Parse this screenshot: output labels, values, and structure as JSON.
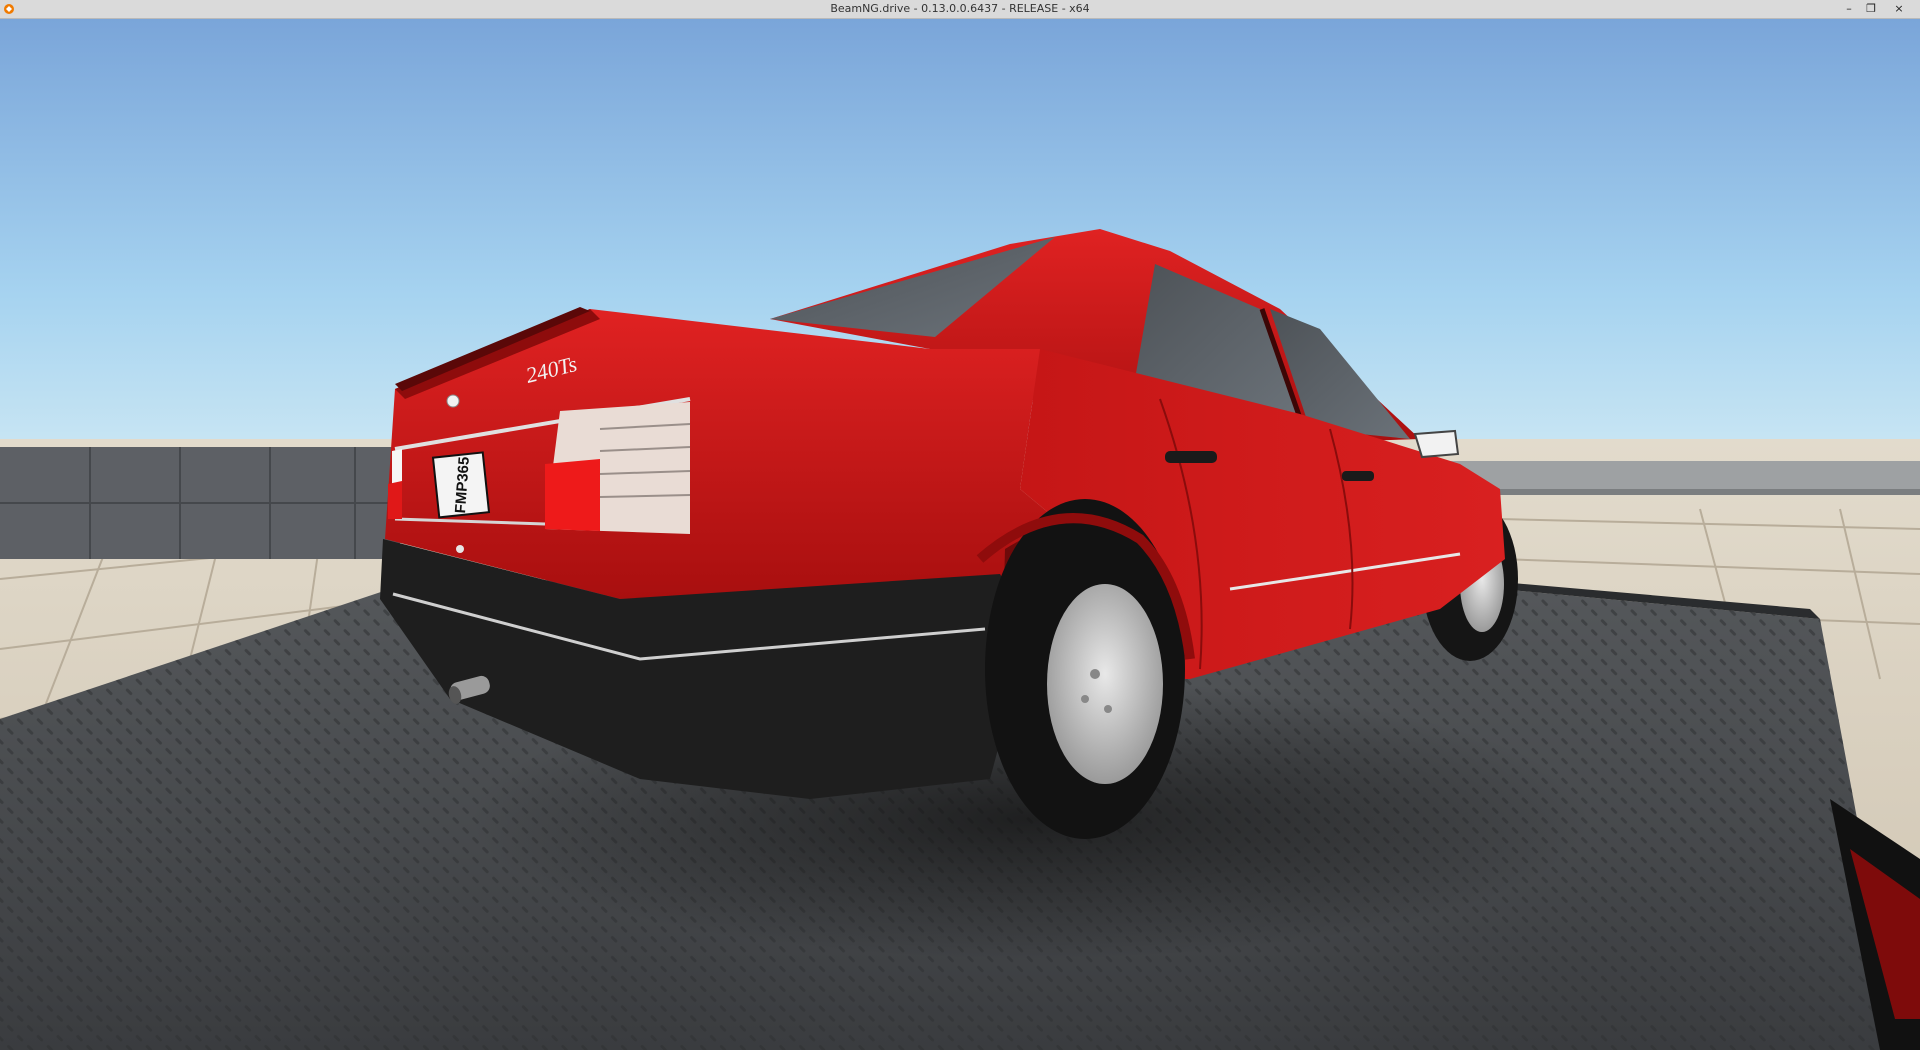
{
  "window": {
    "title": "BeamNG.drive - 0.13.0.0.6437 - RELEASE - x64",
    "controls": {
      "minimize": "–",
      "restore": "❐",
      "close": "×"
    }
  },
  "scene": {
    "car_badge": "240Ts",
    "license_plate": "FMP365"
  },
  "colors": {
    "sky_top": "#7aa5d9",
    "sky_horizon": "#bfe3f3",
    "car_body": "#c81818",
    "bumper": "#1f1f1f",
    "floor_tile": "#d8cfc0",
    "wall": "#5a5d62",
    "platform": "#45484b"
  }
}
